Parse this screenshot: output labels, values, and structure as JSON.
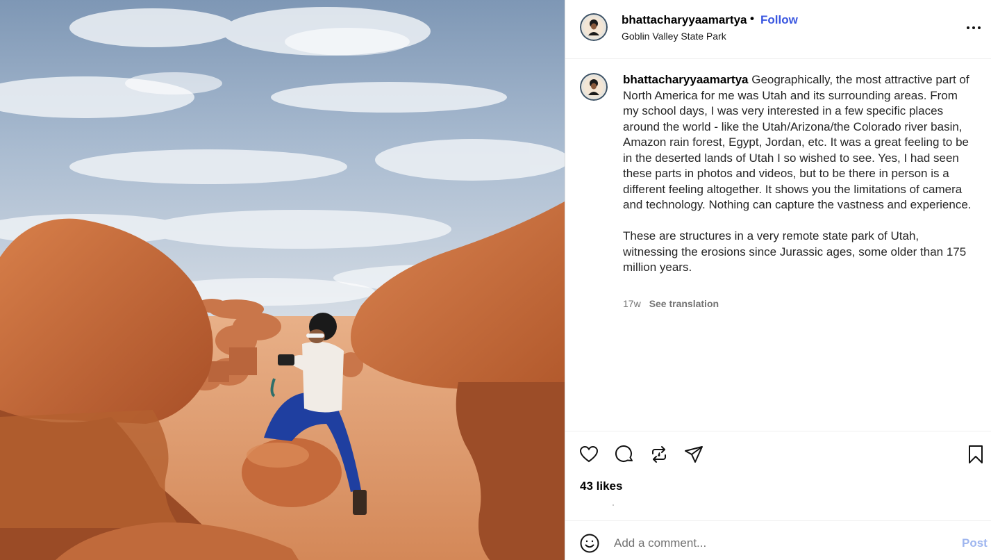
{
  "post": {
    "username": "bhattacharyyaamartya",
    "separator": "•",
    "follow_label": "Follow",
    "location": "Goblin Valley State Park",
    "caption_username": "bhattacharyyaamartya",
    "caption_paragraph_1": "Geographically, the most attractive part of North America for me was Utah and its surrounding areas. From my school days, I was very interested in a few specific places around the world - like the Utah/Arizona/the Colorado river basin, Amazon rain forest, Egypt, Jordan, etc. It was a great feeling to be in the deserted lands of Utah I so wished to see. Yes, I had seen these parts in photos and videos, but to be there in person is a different feeling altogether. It shows you the limitations of camera and technology. Nothing can capture the vastness and experience.",
    "caption_paragraph_2": "These are structures in a very remote state park of Utah, witnessing the erosions since Jurassic ages, some older than 175 million years.",
    "age": "17w",
    "see_translation": "See translation",
    "likes": "43 likes"
  },
  "actions": {
    "icons": [
      "heart-icon",
      "comment-icon",
      "repost-icon",
      "share-icon",
      "bookmark-icon"
    ]
  },
  "comment_box": {
    "placeholder": "Add a comment...",
    "post_label": "Post",
    "emoji_icon": "smiley-icon"
  },
  "colors": {
    "follow": "#3956e0",
    "post_disabled": "#9fb6ef",
    "muted_text": "#737373",
    "sky": "#9fb4cf",
    "rock": "#c7683a",
    "sand": "#e3a475"
  }
}
